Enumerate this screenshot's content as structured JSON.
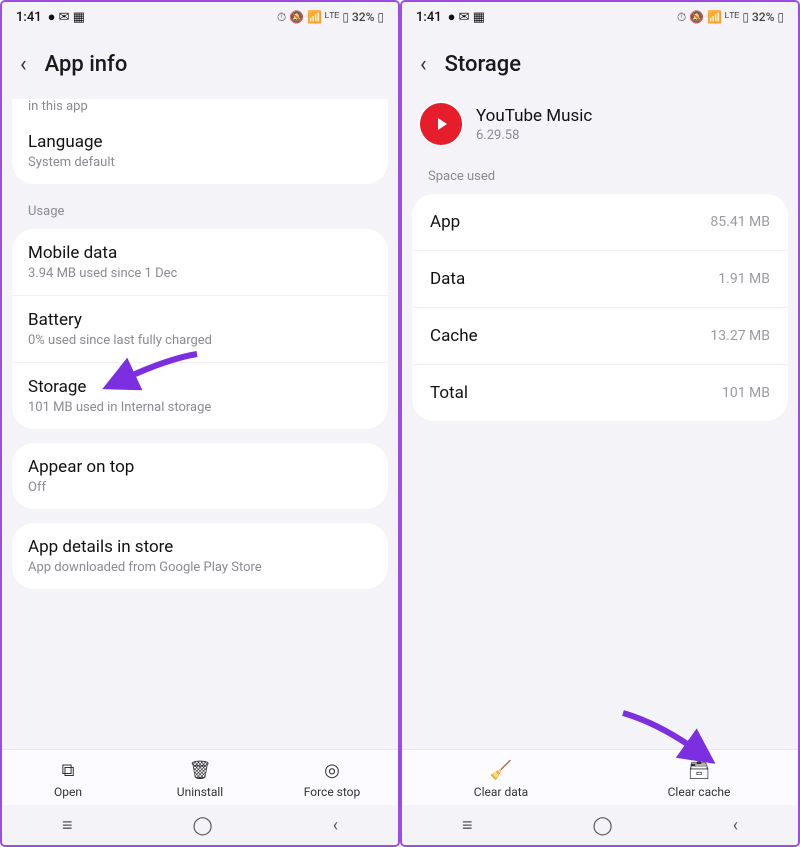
{
  "status": {
    "time": "1:41",
    "icons_left": "● ✉ ▦",
    "icons_right": "⏱ 🔕 📶 ᴸᵀᴱ ▯ 32% ▯"
  },
  "left": {
    "title": "App info",
    "clipped": "in this app",
    "language": {
      "label": "Language",
      "value": "System default"
    },
    "usage_section": "Usage",
    "mobile": {
      "label": "Mobile data",
      "value": "3.94 MB used since 1 Dec"
    },
    "battery": {
      "label": "Battery",
      "value": "0% used since last fully charged"
    },
    "storage": {
      "label": "Storage",
      "value": "101 MB used in Internal storage"
    },
    "appear": {
      "label": "Appear on top",
      "value": "Off"
    },
    "store": {
      "label": "App details in store",
      "value": "App downloaded from Google Play Store"
    },
    "actions": {
      "open": "Open",
      "uninstall": "Uninstall",
      "forcestop": "Force stop"
    }
  },
  "right": {
    "title": "Storage",
    "app": {
      "name": "YouTube Music",
      "version": "6.29.58"
    },
    "space_section": "Space used",
    "rows": {
      "app": {
        "k": "App",
        "v": "85.41 MB"
      },
      "data": {
        "k": "Data",
        "v": "1.91 MB"
      },
      "cache": {
        "k": "Cache",
        "v": "13.27 MB"
      },
      "total": {
        "k": "Total",
        "v": "101 MB"
      }
    },
    "actions": {
      "cleardata": "Clear data",
      "clearcache": "Clear cache"
    }
  }
}
